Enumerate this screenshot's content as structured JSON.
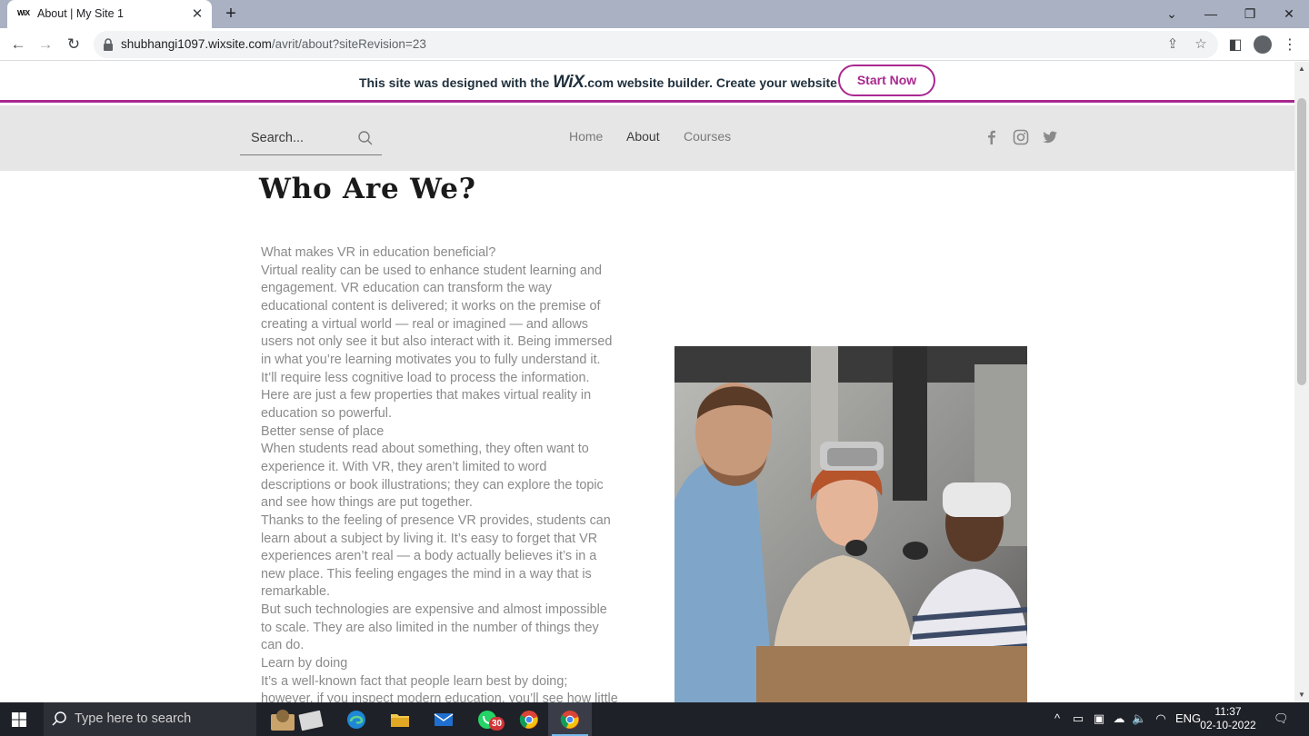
{
  "browser": {
    "tab_favicon": "WiX",
    "tab_title": "About | My Site 1",
    "new_tab_label": "+",
    "url_host": "shubhangi1097.wixsite.com",
    "url_path": "/avrit/about?siteRevision=23"
  },
  "wix_banner": {
    "text_before_logo": "This site was designed with the ",
    "logo_text": "WiX",
    "logo_suffix": ".com",
    "text_after_logo": " website builder. Create your website today.",
    "cta_label": "Start Now",
    "accent_color": "#a9288f"
  },
  "site_header": {
    "search_placeholder": "Search...",
    "nav": [
      {
        "label": "Home",
        "active": false
      },
      {
        "label": "About",
        "active": true
      },
      {
        "label": "Courses",
        "active": false
      }
    ],
    "social": [
      "facebook-icon",
      "instagram-icon",
      "twitter-icon"
    ]
  },
  "content": {
    "title": "Who Are We?",
    "paragraphs": [
      "What makes VR in education beneficial?",
      "Virtual reality can be used to enhance student learning and engagement. VR education can transform the way educational content is delivered; it works on the premise of creating a virtual world — real or imagined — and allows users not only see it but also interact with it. Being immersed in what you’re learning motivates you to fully understand it. It’ll require less cognitive load to process the information.",
      "Here are just a few properties that makes virtual reality in education so powerful.",
      "Better sense of place",
      "When students read about something, they often want to experience it. With VR, they aren’t limited to word descriptions or book illustrations; they can explore the topic and see how things are put together.",
      "Thanks to the feeling of presence VR provides, students can learn about a subject by living it. It’s easy to forget that VR experiences aren’t real — a body actually believes it’s in a new place. This feeling engages the mind in a way that is remarkable.",
      "But such technologies are expensive and almost impossible to scale. They are also limited in the number of things they can do.",
      "Learn by doing",
      "It’s a well-known fact that people learn best by doing; however, if you inspect modern education, you’ll see how little learning"
    ]
  },
  "taskbar": {
    "search_placeholder": "Type here to search",
    "whatsapp_badge": "30",
    "language": "ENG",
    "time": "11:37",
    "date": "02-10-2022"
  }
}
